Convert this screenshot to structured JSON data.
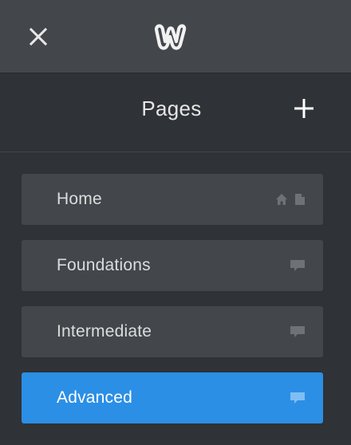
{
  "header": {
    "close_icon": "close-icon",
    "logo_icon": "weebly-logo-icon"
  },
  "pages_panel": {
    "title": "Pages",
    "add_icon": "plus-icon",
    "items": [
      {
        "label": "Home",
        "icons": [
          "home-icon",
          "page-icon"
        ],
        "active": false
      },
      {
        "label": "Foundations",
        "icons": [
          "comment-icon"
        ],
        "active": false
      },
      {
        "label": "Intermediate",
        "icons": [
          "comment-icon"
        ],
        "active": false
      },
      {
        "label": "Advanced",
        "icons": [
          "comment-icon"
        ],
        "active": true
      }
    ]
  },
  "colors": {
    "topbar": "#43474c",
    "panel": "#2f3236",
    "item": "#43474c",
    "active": "#2b8fe6",
    "icon_muted": "#6e7277"
  }
}
